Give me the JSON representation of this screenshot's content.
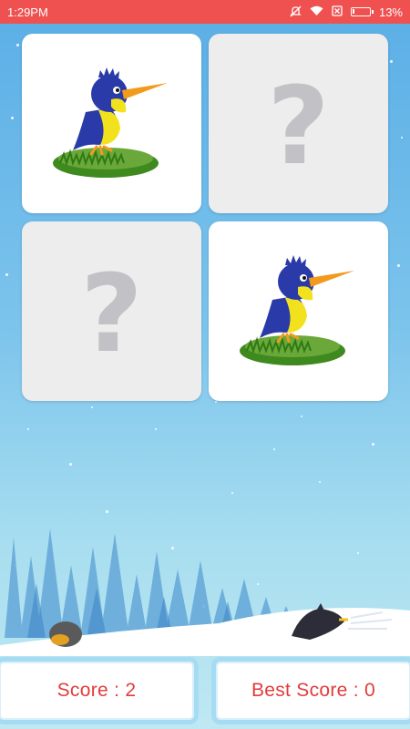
{
  "status_bar": {
    "time": "1:29PM",
    "battery_text": "13%",
    "battery_level": 0.13,
    "icons": [
      "mute-icon",
      "wifi-icon",
      "no-sim-icon",
      "battery-icon"
    ]
  },
  "board": {
    "cards": [
      {
        "id": 1,
        "state": "revealed",
        "image": "kingfisher-bird"
      },
      {
        "id": 2,
        "state": "hidden",
        "symbol": "?"
      },
      {
        "id": 3,
        "state": "hidden",
        "symbol": "?"
      },
      {
        "id": 4,
        "state": "revealed",
        "image": "kingfisher-bird"
      }
    ]
  },
  "score": {
    "label": "Score : 2",
    "value": 2
  },
  "best_score": {
    "label": "Best Score : 0",
    "value": 0
  },
  "colors": {
    "status_bar": "#ef5050",
    "score_text": "#e33b3b",
    "score_border": "#a6dcf3",
    "hidden_card": "#ededed",
    "question_mark": "#c2c2c6"
  }
}
